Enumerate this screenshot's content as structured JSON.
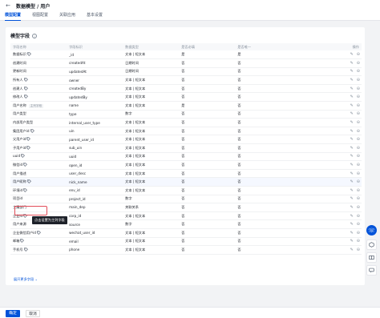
{
  "header": {
    "back_icon": "arrow-left-icon",
    "title": "数据模型 / 用户"
  },
  "tabs": [
    {
      "label": "模型配置",
      "active": true
    },
    {
      "label": "视图配置",
      "active": false
    },
    {
      "label": "关联应用",
      "active": false
    },
    {
      "label": "基本设置",
      "active": false
    }
  ],
  "section": {
    "title": "模型字段"
  },
  "table": {
    "columns": [
      "字段名称",
      "字段标识",
      "数据类型",
      "是否必填",
      "是否唯一",
      "操作"
    ],
    "rows": [
      {
        "name": "数据标识",
        "id": "_id",
        "type": "文本 | 短文本",
        "required": "是",
        "unique": "是",
        "tag": true
      },
      {
        "name": "创建时间",
        "id": "createdAt",
        "type": "日期时间",
        "required": "否",
        "unique": "否"
      },
      {
        "name": "更新时间",
        "id": "updatedAt",
        "type": "日期时间",
        "required": "否",
        "unique": "否"
      },
      {
        "name": "所有人",
        "id": "owner",
        "type": "文本 | 短文本",
        "required": "否",
        "unique": "否",
        "tag": true
      },
      {
        "name": "创建人",
        "id": "createdBy",
        "type": "文本 | 短文本",
        "required": "否",
        "unique": "否",
        "tag": true
      },
      {
        "name": "修改人",
        "id": "updatedBy",
        "type": "文本 | 短文本",
        "required": "否",
        "unique": "否",
        "tag": true
      },
      {
        "name": "用户名称",
        "id": "name",
        "type": "文本 | 短文本",
        "required": "是",
        "unique": "否",
        "badge": "主列字段"
      },
      {
        "name": "用户类型",
        "id": "type",
        "type": "数字",
        "required": "否",
        "unique": "否"
      },
      {
        "name": "内部用户类型",
        "id": "internal_user_type",
        "type": "文本 | 短文本",
        "required": "否",
        "unique": "否"
      },
      {
        "name": "集团用户id",
        "id": "uin",
        "type": "文本 | 短文本",
        "required": "否",
        "unique": "否",
        "tag": true
      },
      {
        "name": "父用户id",
        "id": "parent_user_id",
        "type": "文本 | 短文本",
        "required": "否",
        "unique": "否",
        "tag": true
      },
      {
        "name": "子用户id",
        "id": "sub_uin",
        "type": "文本 | 短文本",
        "required": "否",
        "unique": "否",
        "tag": true
      },
      {
        "name": "uuid",
        "id": "uuid",
        "type": "文本 | 短文本",
        "required": "否",
        "unique": "否",
        "tag": true
      },
      {
        "name": "微信id",
        "id": "open_id",
        "type": "文本 | 短文本",
        "required": "否",
        "unique": "否",
        "tag": true
      },
      {
        "name": "用户描述",
        "id": "user_desc",
        "type": "文本 | 短文本",
        "required": "否",
        "unique": "否"
      },
      {
        "name": "用户昵称",
        "id": "nick_name",
        "type": "文本 | 短文本",
        "required": "否",
        "unique": "否",
        "tag": true,
        "highlight": true
      },
      {
        "name": "环境id",
        "id": "env_id",
        "type": "文本 | 短文本",
        "required": "否",
        "unique": "否",
        "tag": true
      },
      {
        "name": "项目id",
        "id": "project_id",
        "type": "数字",
        "required": "否",
        "unique": "否"
      },
      {
        "name": "主属部门",
        "id": "main_dep",
        "type": "关联关系",
        "required": "否",
        "unique": "否"
      },
      {
        "name": "企业id",
        "id": "corp_id",
        "type": "文本 | 短文本",
        "required": "否",
        "unique": "否",
        "tag": true
      },
      {
        "name": "用户来源",
        "id": "source",
        "type": "数字",
        "required": "否",
        "unique": "否"
      },
      {
        "name": "企业微信用户id",
        "id": "wechat_user_id",
        "type": "文本 | 短文本",
        "required": "否",
        "unique": "否",
        "tag": true
      },
      {
        "name": "邮箱",
        "id": "email",
        "type": "文本 | 短文本",
        "required": "否",
        "unique": "否",
        "tag": true
      },
      {
        "name": "手机号",
        "id": "phone",
        "type": "文本 | 短文本",
        "required": "否",
        "unique": "否",
        "tag": true
      }
    ]
  },
  "tooltip": "点击设置为主列字段",
  "more_link": "展开更多字段",
  "footer": {
    "confirm": "确定",
    "cancel": "取消"
  },
  "icons": {
    "tag": "tag-icon",
    "edit": "pencil-icon",
    "delete": "delete-icon"
  },
  "colors": {
    "primary": "#0052d9",
    "highlight_border": "#e34d59"
  }
}
